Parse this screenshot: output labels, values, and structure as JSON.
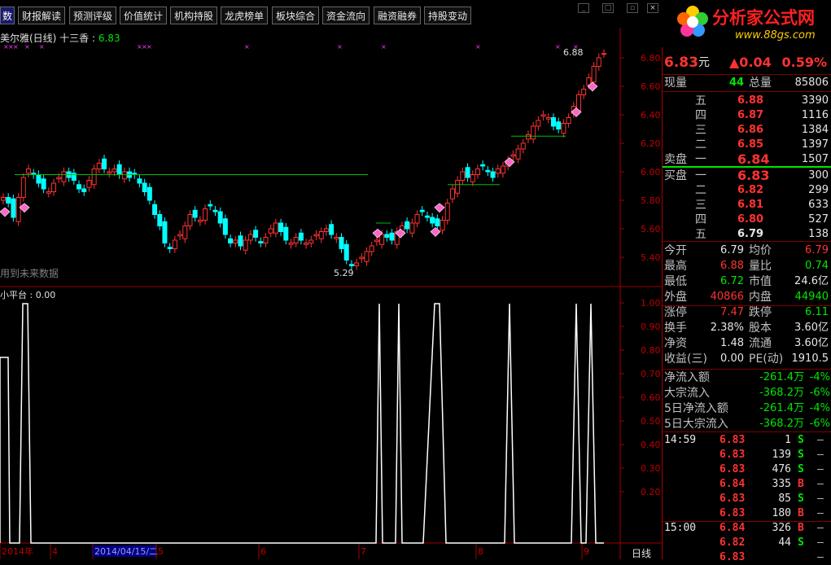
{
  "toolbar": {
    "tabs": [
      "数",
      "财报解读",
      "预测评级",
      "价值统计",
      "机构持股",
      "龙虎榜单",
      "板块综合",
      "资金流向",
      "融资融券",
      "持股变动"
    ]
  },
  "logo": {
    "title": "分析家公式网",
    "url": "www.88gs.com"
  },
  "chart": {
    "title_left": "美尔雅(日线) 十三香",
    "title_value_label": "6.83",
    "high_marker": "6.88",
    "low_marker": "5.29",
    "note": "用到未来数据",
    "price_ticks": [
      "6.80",
      "6.60",
      "6.40",
      "6.20",
      "6.00",
      "5.80",
      "5.60",
      "5.40"
    ],
    "indicator_title": "小平台 : 0.00",
    "indicator_ticks": [
      "1.00",
      "0.90",
      "0.80",
      "0.70",
      "0.60",
      "0.50",
      "0.40",
      "0.30",
      "0.20"
    ],
    "date_labels": [
      "2014年",
      "4",
      "2014/04/15/二",
      "5",
      "6",
      "7",
      "8",
      "9"
    ],
    "period": "日线",
    "colors": {
      "up": "#ff3232",
      "down": "#00ffff",
      "ma": "#00c000",
      "axis": "#a00000",
      "diamond": "#ff66cc"
    }
  },
  "quote": {
    "name_partial": "美尔雅",
    "price": "6.83",
    "unit": "元",
    "change": "▲0.04",
    "change_pct": "0.59%",
    "volume_label": "现量",
    "volume_now": "44",
    "total_label": "总量",
    "total": "85806",
    "sell_label": "卖盘",
    "buy_label": "买盘",
    "asks": [
      {
        "level": "五",
        "price": "6.88",
        "vol": "3390"
      },
      {
        "level": "四",
        "price": "6.87",
        "vol": "1116"
      },
      {
        "level": "三",
        "price": "6.86",
        "vol": "1384"
      },
      {
        "level": "二",
        "price": "6.85",
        "vol": "1397"
      },
      {
        "level": "一",
        "price": "6.84",
        "vol": "1507"
      }
    ],
    "bids": [
      {
        "level": "一",
        "price": "6.83",
        "vol": "300"
      },
      {
        "level": "二",
        "price": "6.82",
        "vol": "299"
      },
      {
        "level": "三",
        "price": "6.81",
        "vol": "633"
      },
      {
        "level": "四",
        "price": "6.80",
        "vol": "527"
      },
      {
        "level": "五",
        "price": "6.79",
        "vol": "138"
      }
    ],
    "stats": [
      {
        "l1": "今开",
        "v1": "6.79",
        "c1": "white",
        "l2": "均价",
        "v2": "6.79",
        "c2": "red"
      },
      {
        "l1": "最高",
        "v1": "6.88",
        "c1": "red",
        "l2": "量比",
        "v2": "0.74",
        "c2": "green"
      },
      {
        "l1": "最低",
        "v1": "6.72",
        "c1": "green",
        "l2": "市值",
        "v2": "24.6亿",
        "c2": "white"
      },
      {
        "l1": "外盘",
        "v1": "40866",
        "c1": "red",
        "l2": "内盘",
        "v2": "44940",
        "c2": "green"
      },
      {
        "l1": "涨停",
        "v1": "7.47",
        "c1": "red",
        "l2": "跌停",
        "v2": "6.11",
        "c2": "green"
      },
      {
        "l1": "换手",
        "v1": "2.38%",
        "c1": "white",
        "l2": "股本",
        "v2": "3.60亿",
        "c2": "white"
      },
      {
        "l1": "净资",
        "v1": "1.48",
        "c1": "white",
        "l2": "流通",
        "v2": "3.60亿",
        "c2": "white"
      },
      {
        "l1": "收益(三)",
        "v1": "0.00",
        "c1": "white",
        "l2": "PE(动)",
        "v2": "1910.5",
        "c2": "white"
      }
    ],
    "flows": [
      {
        "label": "净流入额",
        "value": "-261.4万",
        "pct": "-4%"
      },
      {
        "label": "大宗流入",
        "value": "-368.2万",
        "pct": "-6%"
      },
      {
        "label": "5日净流入额",
        "value": "-261.4万",
        "pct": "-4%"
      },
      {
        "label": "5日大宗流入",
        "value": "-368.2万",
        "pct": "-6%"
      }
    ],
    "ticks": [
      {
        "time": "14:59",
        "price": "6.83",
        "vol": "1",
        "side": "S"
      },
      {
        "time": "",
        "price": "6.83",
        "vol": "139",
        "side": "S"
      },
      {
        "time": "",
        "price": "6.83",
        "vol": "476",
        "side": "S"
      },
      {
        "time": "",
        "price": "6.84",
        "vol": "335",
        "side": "B"
      },
      {
        "time": "",
        "price": "6.83",
        "vol": "85",
        "side": "S"
      },
      {
        "time": "",
        "price": "6.83",
        "vol": "180",
        "side": "B"
      },
      {
        "time": "15:00",
        "price": "6.84",
        "vol": "326",
        "side": "B"
      },
      {
        "time": "",
        "price": "6.82",
        "vol": "44",
        "side": "S"
      },
      {
        "time": "",
        "price": "6.83",
        "vol": "",
        "side": ""
      }
    ]
  }
}
